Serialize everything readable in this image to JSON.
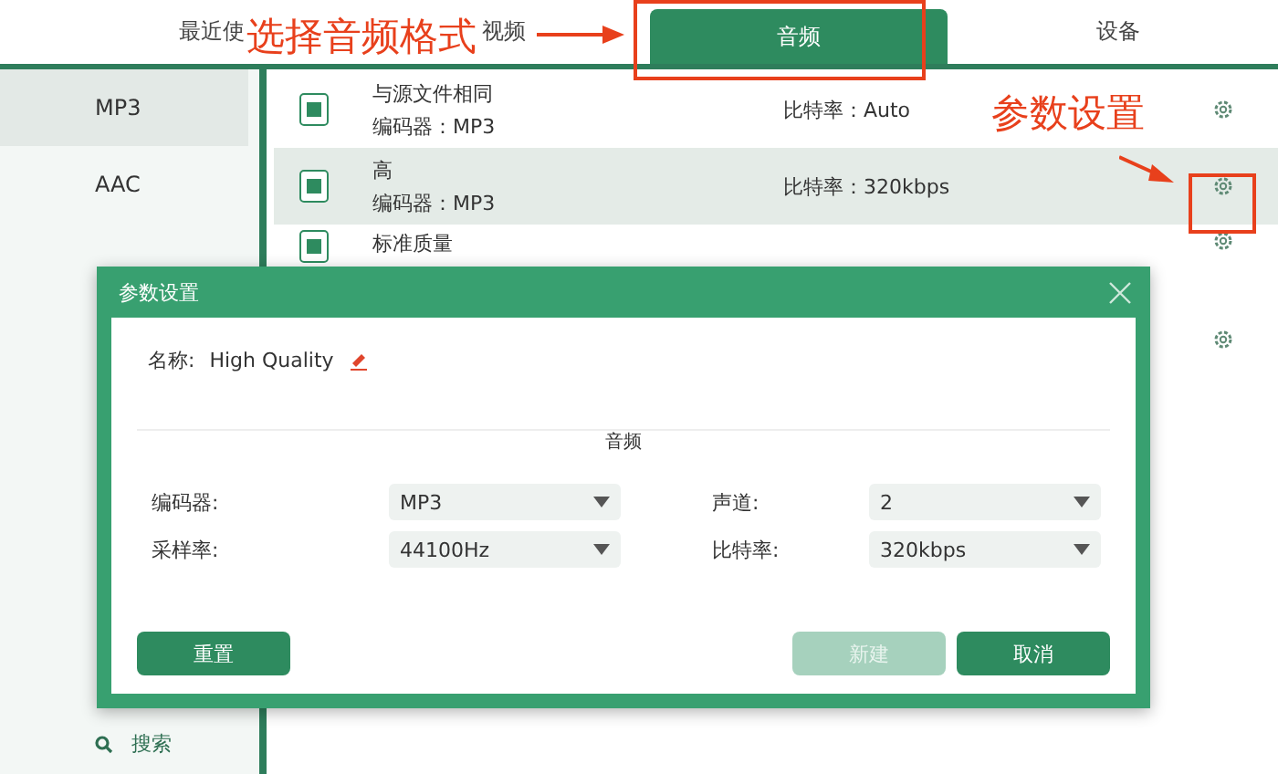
{
  "tabs": [
    {
      "label": "最近使",
      "selected": false
    },
    {
      "label": "视频",
      "selected": false
    },
    {
      "label": "音频",
      "selected": true
    },
    {
      "label": "设备",
      "selected": false
    }
  ],
  "sidebar": {
    "items": [
      {
        "label": "MP3",
        "selected": true
      },
      {
        "label": "AAC",
        "selected": false
      }
    ],
    "search": {
      "placeholder": "搜索"
    }
  },
  "presets": [
    {
      "name": "与源文件相同",
      "encoder": "编码器：MP3",
      "bitrate": "比特率：Auto",
      "selected": false
    },
    {
      "name": "高",
      "encoder": "编码器：MP3",
      "bitrate": "比特率：320kbps",
      "selected": true
    },
    {
      "name": "标准质量",
      "selected": false
    },
    {
      "selected": false
    }
  ],
  "dialog": {
    "title": "参数设置",
    "name_label": "名称:",
    "name_value": "High Quality",
    "section": "音频",
    "fields": [
      {
        "label": "编码器:",
        "value": "MP3"
      },
      {
        "label": "声道:",
        "value": "2"
      },
      {
        "label": "采样率:",
        "value": "44100Hz"
      },
      {
        "label": "比特率:",
        "value": "320kbps"
      }
    ],
    "buttons": [
      {
        "label": "重置",
        "disabled": false
      },
      {
        "label": "新建",
        "disabled": true
      },
      {
        "label": "取消",
        "disabled": false
      }
    ]
  },
  "annotations": [
    "选择音频格式",
    "参数设置"
  ]
}
